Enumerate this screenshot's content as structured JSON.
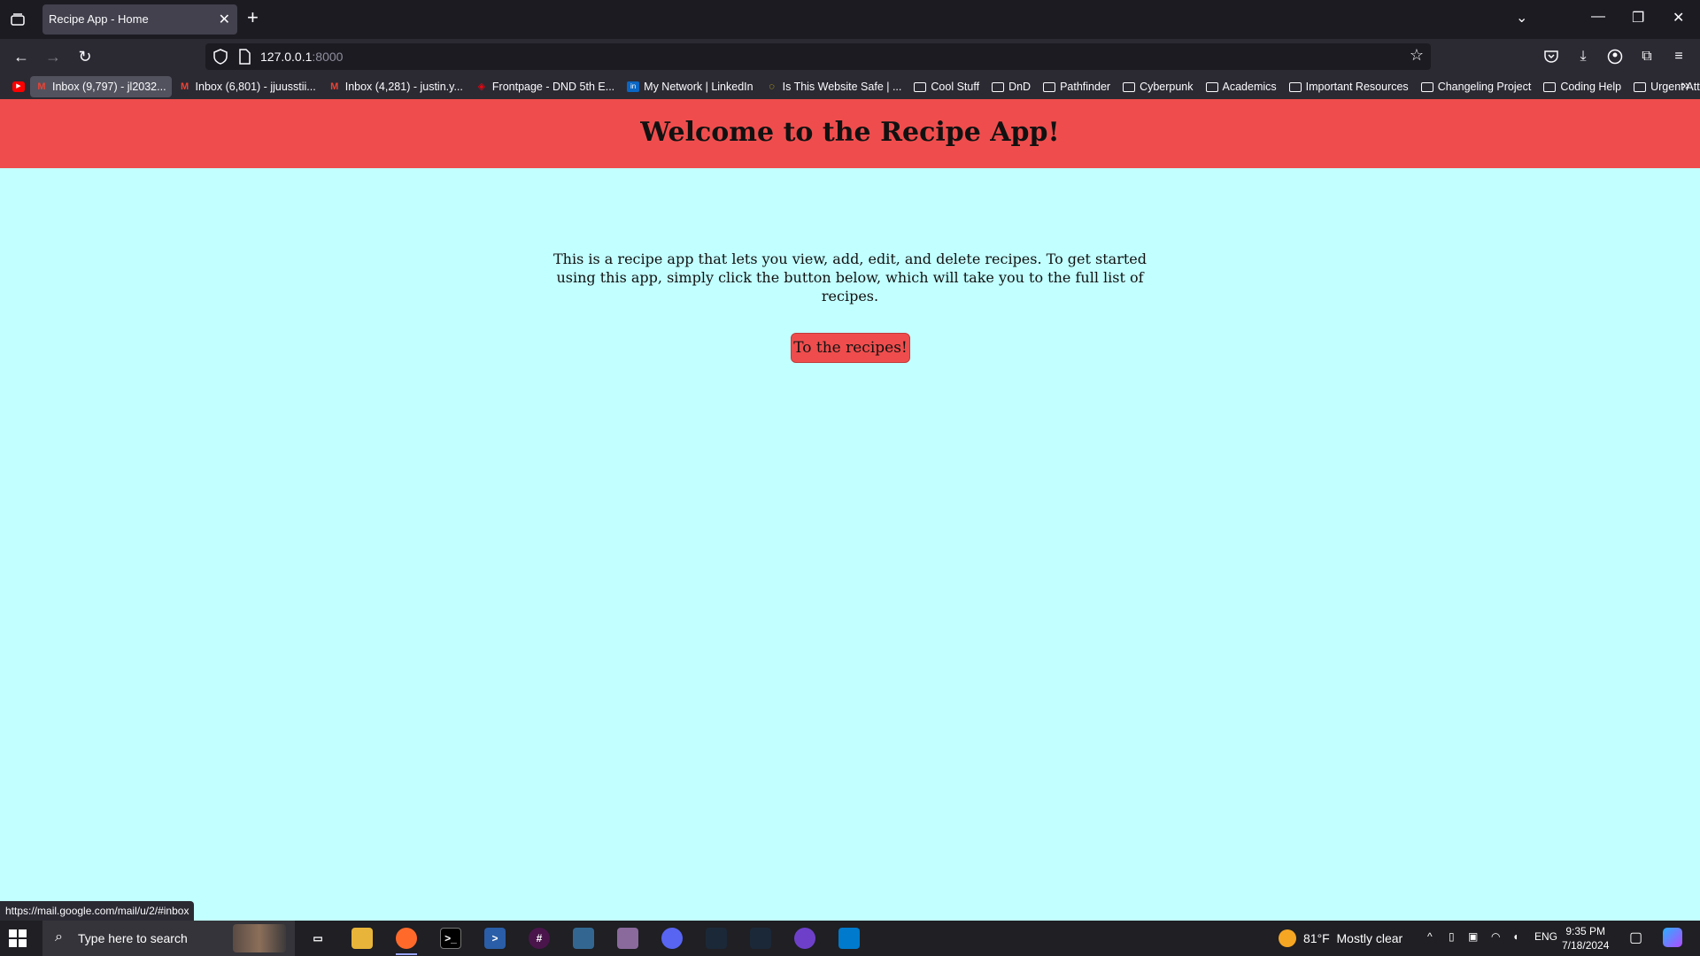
{
  "browser": {
    "tab_title": "Recipe App - Home",
    "url_host": "127.0.0.1",
    "url_port": ":8000",
    "status_url": "https://mail.google.com/mail/u/2/#inbox"
  },
  "bookmarks": [
    {
      "label": "Inbox (9,797) - jl2032...",
      "icon": "gmail-icon"
    },
    {
      "label": "Inbox (6,801) - jjuusstii...",
      "icon": "gmail-icon"
    },
    {
      "label": "Inbox (4,281) - justin.y...",
      "icon": "gmail-icon"
    },
    {
      "label": "Frontpage - DND 5th E...",
      "icon": "dndbeyond-icon"
    },
    {
      "label": "My Network | LinkedIn",
      "icon": "linkedin-icon"
    },
    {
      "label": "Is This Website Safe | ...",
      "icon": "loading-icon"
    },
    {
      "label": "Cool Stuff",
      "icon": "folder-icon"
    },
    {
      "label": "DnD",
      "icon": "folder-icon"
    },
    {
      "label": "Pathfinder",
      "icon": "folder-icon"
    },
    {
      "label": "Cyberpunk",
      "icon": "folder-icon"
    },
    {
      "label": "Academics",
      "icon": "folder-icon"
    },
    {
      "label": "Important Resources",
      "icon": "folder-icon"
    },
    {
      "label": "Changeling Project",
      "icon": "folder-icon"
    },
    {
      "label": "Coding Help",
      "icon": "folder-icon"
    },
    {
      "label": "Urgent Attention",
      "icon": "folder-icon"
    }
  ],
  "page": {
    "heading": "Welcome to the Recipe App!",
    "intro": "This is a recipe app that lets you view, add, edit, and delete recipes. To get started using this app, simply click the button below, which will take you to the full list of recipes.",
    "button": "To the recipes!"
  },
  "taskbar": {
    "search_placeholder": "Type here to search",
    "weather_temp": "81°F",
    "weather_text": "Mostly clear",
    "language": "ENG",
    "time": "9:35 PM",
    "date": "7/18/2024"
  },
  "colors": {
    "page_bg": "#c2ffff",
    "header_bg": "#ef4d4d",
    "button_bg": "#ef4d4d"
  }
}
